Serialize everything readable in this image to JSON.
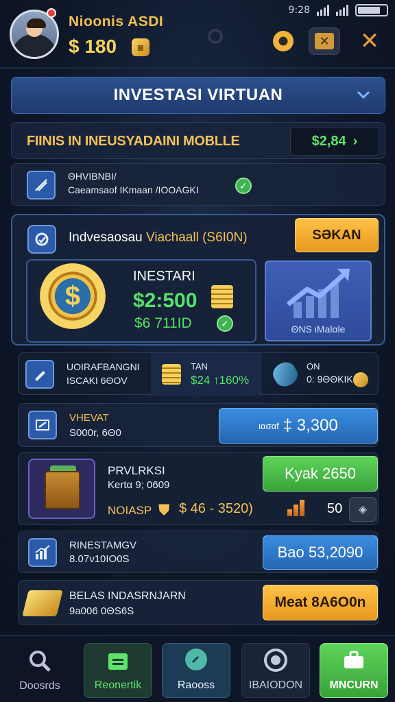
{
  "status_bar": {
    "time": "9:28"
  },
  "header": {
    "user_name": "Nioonis ASDI",
    "balance": "$ 180"
  },
  "title_bar": {
    "title": "INVESTASI VIRTUAN"
  },
  "platform_row": {
    "label": "FIINIS IN INEUSYADAINI MOBLLE",
    "value": "$2,84",
    "arrow": "›"
  },
  "verify_row": {
    "line1": "ΘΗVΙΒΝΒΙ/",
    "line2": "Caeamsaof IKmaan /IOOAGKI"
  },
  "investment_card": {
    "title_part1": "Indvesaosau",
    "title_part2": "Viachaall (S6I0N)",
    "action_label": "SƏΚΑΝ",
    "sub_label": "INESTARI",
    "amount": "$2:500",
    "amount_secondary": "$6 711ID",
    "chart_caption": "ΘΝS ιMalαle"
  },
  "stats_row": {
    "left_line1": "UOIRAFBANGNI",
    "left_line2": "ISCAKI 6ΘΟV",
    "mid_line1": "TAN",
    "mid_line2": "$24 ↑160%",
    "right_line1": "ON",
    "right_line2": "0: 9ΘΘΚΙΚ"
  },
  "wallet_row": {
    "line1": "VHEVAT",
    "line2": "S000r, 6Θ0",
    "button_prefix": "ιασαf",
    "button_amount": "‡ 3,300"
  },
  "transaction_row": {
    "title": "PRVLRKSI",
    "subtitle": "Kertα 9; 0609",
    "meta_label": "NOIASP",
    "meta_range": "$ 46 - 3520)",
    "count": "50",
    "button": "Kyak 2650"
  },
  "strategy_row": {
    "line1": "RINESTAMGV",
    "line2": "8.07ν10ΙΟ0S",
    "button": "Bao 53,2090"
  },
  "balance_row": {
    "line1": "BELAS INDASRNJARN",
    "line2": "9a006 0ΘS6S",
    "button": "Meat 8Α6Ο0n"
  },
  "nav": {
    "tabs": [
      {
        "label": "Doosrds",
        "icon": "search-icon"
      },
      {
        "label": "Reonertik",
        "icon": "wallet-icon"
      },
      {
        "label": "Raooss",
        "icon": "chat-icon"
      },
      {
        "label": "IBAIODON",
        "icon": "target-icon"
      },
      {
        "label": "MNCURN",
        "icon": "briefcase-icon"
      }
    ]
  },
  "colors": {
    "accent_gold": "#f3c15a",
    "accent_green": "#5fe36a",
    "accent_blue": "#2c4f8c",
    "accent_orange": "#e8981e"
  }
}
